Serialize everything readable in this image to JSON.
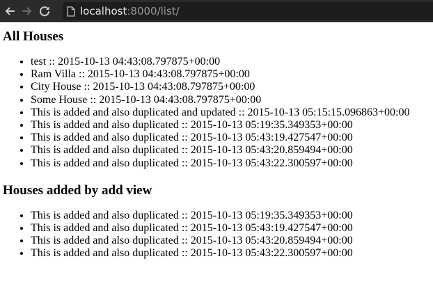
{
  "browser": {
    "url_host": "localhost",
    "url_rest": ":8000/list/",
    "colors": {
      "toolbar": "#2b2b2b",
      "omnibox": "#1d1d1d",
      "host_text": "#e8e8e8",
      "rest_text": "#9a9a9a"
    },
    "icons": [
      "back-arrow-icon",
      "forward-arrow-icon",
      "reload-icon",
      "page-icon"
    ]
  },
  "all_houses": {
    "heading": "All Houses",
    "items": [
      "test :: 2015-10-13 04:43:08.797875+00:00",
      "Ram Villa :: 2015-10-13 04:43:08.797875+00:00",
      "City House :: 2015-10-13 04:43:08.797875+00:00",
      "Some House :: 2015-10-13 04:43:08.797875+00:00",
      "This is added and also duplicated and updated :: 2015-10-13 05:15:15.096863+00:00",
      "This is added and also duplicated :: 2015-10-13 05:19:35.349353+00:00",
      "This is added and also duplicated :: 2015-10-13 05:43:19.427547+00:00",
      "This is added and also duplicated :: 2015-10-13 05:43:20.859494+00:00",
      "This is added and also duplicated :: 2015-10-13 05:43:22.300597+00:00"
    ]
  },
  "added_houses": {
    "heading": "Houses added by add view",
    "items": [
      "This is added and also duplicated :: 2015-10-13 05:19:35.349353+00:00",
      "This is added and also duplicated :: 2015-10-13 05:43:19.427547+00:00",
      "This is added and also duplicated :: 2015-10-13 05:43:20.859494+00:00",
      "This is added and also duplicated :: 2015-10-13 05:43:22.300597+00:00"
    ]
  }
}
